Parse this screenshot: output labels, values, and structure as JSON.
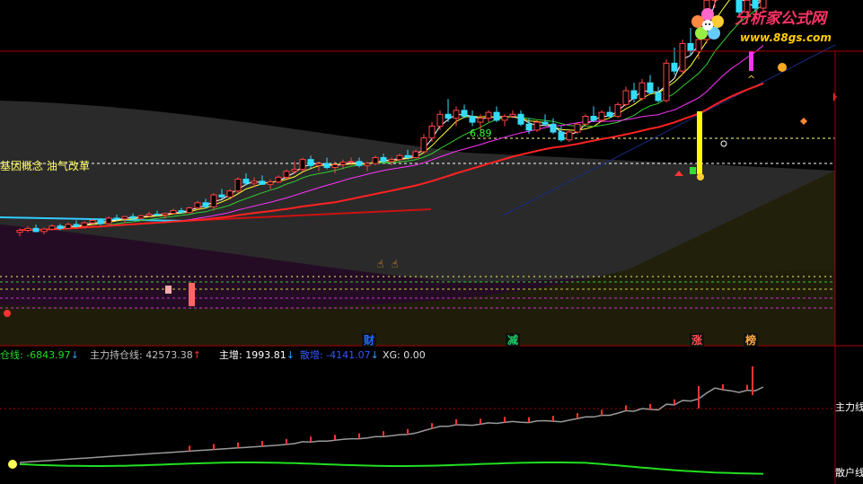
{
  "logo": {
    "name": "分析家公式网",
    "url": "www.88gs.com"
  },
  "chart_data": {
    "type": "candlestick",
    "price_label": "6.89",
    "concept_text": "基因概念 油气改革",
    "badges": [
      {
        "text": "财",
        "color": "#1e6bff"
      },
      {
        "text": "减",
        "color": "#22cc66"
      },
      {
        "text": "涨",
        "color": "#ff5050"
      },
      {
        "text": "榜",
        "color": "#ffaa44"
      }
    ],
    "indicators": [
      {
        "label": "仓线:",
        "value": "-6843.97",
        "arrow": "↓",
        "color": "#22dd22",
        "arrow_color": "#2aa0ff"
      },
      {
        "label": "主力持仓线:",
        "value": "42573.38",
        "arrow": "↑",
        "color": "#c0c0c0",
        "arrow_color": "#ff3030"
      },
      {
        "label": "主增:",
        "value": "1993.81",
        "arrow": "↓",
        "color": "#ffffff",
        "arrow_color": "#2aa0ff"
      },
      {
        "label": "散增:",
        "value": "-4141.07",
        "arrow": "↓",
        "color": "#3355ff",
        "arrow_color": "#2aa0ff"
      },
      {
        "label": "XG:",
        "value": "0.00",
        "arrow": "",
        "color": "#e0e0e0",
        "arrow_color": "#e0e0e0"
      }
    ],
    "lower_labels": [
      "主力线",
      "散户线"
    ],
    "candles": [
      [
        3.5,
        3.6,
        3.4,
        3.55
      ],
      [
        3.55,
        3.65,
        3.5,
        3.6
      ],
      [
        3.6,
        3.7,
        3.5,
        3.52
      ],
      [
        3.52,
        3.62,
        3.45,
        3.58
      ],
      [
        3.58,
        3.7,
        3.55,
        3.66
      ],
      [
        3.66,
        3.72,
        3.55,
        3.6
      ],
      [
        3.6,
        3.75,
        3.58,
        3.7
      ],
      [
        3.7,
        3.8,
        3.62,
        3.65
      ],
      [
        3.65,
        3.78,
        3.6,
        3.74
      ],
      [
        3.74,
        3.85,
        3.7,
        3.8
      ],
      [
        3.8,
        3.85,
        3.68,
        3.72
      ],
      [
        3.72,
        3.9,
        3.7,
        3.86
      ],
      [
        3.86,
        3.95,
        3.8,
        3.84
      ],
      [
        3.84,
        3.92,
        3.75,
        3.9
      ],
      [
        3.9,
        3.98,
        3.82,
        3.86
      ],
      [
        3.86,
        3.95,
        3.8,
        3.92
      ],
      [
        3.92,
        4.02,
        3.88,
        3.96
      ],
      [
        3.96,
        4.05,
        3.9,
        3.94
      ],
      [
        3.94,
        4.0,
        3.85,
        3.98
      ],
      [
        3.98,
        4.1,
        3.95,
        4.05
      ],
      [
        4.05,
        4.12,
        3.98,
        4.0
      ],
      [
        4.0,
        4.15,
        3.98,
        4.12
      ],
      [
        4.12,
        4.3,
        4.08,
        4.25
      ],
      [
        4.25,
        4.35,
        4.1,
        4.15
      ],
      [
        4.15,
        4.5,
        4.05,
        4.45
      ],
      [
        4.45,
        4.6,
        4.35,
        4.4
      ],
      [
        4.4,
        4.6,
        4.38,
        4.55
      ],
      [
        4.55,
        4.9,
        4.5,
        4.85
      ],
      [
        4.85,
        5.0,
        4.7,
        4.75
      ],
      [
        4.75,
        4.9,
        4.65,
        4.8
      ],
      [
        4.8,
        4.95,
        4.7,
        4.72
      ],
      [
        4.72,
        4.85,
        4.6,
        4.78
      ],
      [
        4.78,
        4.95,
        4.75,
        4.9
      ],
      [
        4.9,
        5.1,
        4.85,
        5.05
      ],
      [
        5.05,
        5.3,
        5.0,
        5.1
      ],
      [
        5.1,
        5.4,
        5.05,
        5.35
      ],
      [
        5.35,
        5.45,
        5.1,
        5.2
      ],
      [
        5.2,
        5.3,
        5.05,
        5.25
      ],
      [
        5.25,
        5.4,
        5.1,
        5.15
      ],
      [
        5.15,
        5.3,
        5.0,
        5.22
      ],
      [
        5.22,
        5.35,
        5.1,
        5.28
      ],
      [
        5.28,
        5.4,
        5.2,
        5.3
      ],
      [
        5.3,
        5.4,
        5.15,
        5.2
      ],
      [
        5.2,
        5.3,
        5.05,
        5.25
      ],
      [
        5.25,
        5.45,
        5.2,
        5.4
      ],
      [
        5.4,
        5.5,
        5.25,
        5.3
      ],
      [
        5.3,
        5.4,
        5.2,
        5.35
      ],
      [
        5.35,
        5.5,
        5.3,
        5.45
      ],
      [
        5.45,
        5.6,
        5.35,
        5.4
      ],
      [
        5.4,
        5.6,
        5.38,
        5.55
      ],
      [
        5.55,
        6.0,
        5.5,
        5.9
      ],
      [
        5.9,
        6.3,
        5.8,
        6.2
      ],
      [
        6.2,
        6.6,
        6.1,
        6.5
      ],
      [
        6.5,
        6.89,
        6.3,
        6.4
      ],
      [
        6.4,
        6.7,
        6.2,
        6.6
      ],
      [
        6.6,
        6.75,
        6.4,
        6.45
      ],
      [
        6.45,
        6.6,
        6.2,
        6.3
      ],
      [
        6.3,
        6.5,
        6.1,
        6.4
      ],
      [
        6.4,
        6.6,
        6.3,
        6.55
      ],
      [
        6.55,
        6.7,
        6.3,
        6.35
      ],
      [
        6.35,
        6.5,
        6.2,
        6.45
      ],
      [
        6.45,
        6.6,
        6.4,
        6.5
      ],
      [
        6.5,
        6.6,
        6.2,
        6.25
      ],
      [
        6.25,
        6.4,
        6.0,
        6.1
      ],
      [
        6.1,
        6.35,
        6.05,
        6.3
      ],
      [
        6.3,
        6.5,
        6.2,
        6.25
      ],
      [
        6.25,
        6.4,
        6.0,
        6.05
      ],
      [
        6.05,
        6.2,
        5.8,
        5.85
      ],
      [
        5.85,
        6.1,
        5.8,
        6.05
      ],
      [
        6.05,
        6.3,
        6.0,
        6.25
      ],
      [
        6.25,
        6.5,
        6.2,
        6.45
      ],
      [
        6.45,
        6.7,
        6.3,
        6.35
      ],
      [
        6.35,
        6.6,
        6.3,
        6.55
      ],
      [
        6.55,
        6.7,
        6.4,
        6.45
      ],
      [
        6.45,
        6.8,
        6.4,
        6.75
      ],
      [
        6.75,
        7.2,
        6.7,
        7.1
      ],
      [
        7.1,
        7.3,
        6.8,
        6.9
      ],
      [
        6.9,
        7.4,
        6.85,
        7.3
      ],
      [
        7.3,
        7.5,
        7.0,
        7.05
      ],
      [
        7.05,
        7.2,
        6.8,
        6.85
      ],
      [
        6.85,
        7.9,
        6.8,
        7.8
      ],
      [
        7.8,
        8.2,
        7.5,
        7.6
      ],
      [
        7.6,
        8.4,
        7.5,
        8.3
      ],
      [
        8.3,
        8.7,
        8.0,
        8.1
      ],
      [
        8.1,
        8.5,
        7.9,
        8.4
      ],
      [
        8.4,
        9.5,
        8.3,
        9.4
      ],
      [
        9.4,
        10.4,
        9.2,
        10.2
      ],
      [
        10.2,
        10.5,
        9.6,
        9.8
      ],
      [
        9.8,
        10.2,
        9.4,
        9.5
      ],
      [
        9.5,
        9.9,
        9.0,
        9.1
      ],
      [
        9.1,
        9.6,
        8.8,
        9.4
      ],
      [
        9.4,
        9.8,
        9.1,
        9.2
      ],
      [
        9.2,
        9.9,
        9.1,
        9.8
      ]
    ]
  }
}
